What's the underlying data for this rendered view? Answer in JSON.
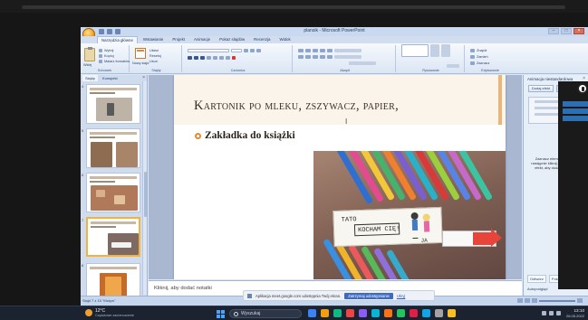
{
  "window": {
    "title": "plansik - Microsoft PowerPoint",
    "controls": [
      "–",
      "□",
      "×"
    ]
  },
  "ribbon": {
    "tabs": [
      "Narzędzia główne",
      "Wstawianie",
      "Projekt",
      "Animacje",
      "Pokaz slajdów",
      "Recenzja",
      "Widok"
    ],
    "active_tab": "Narzędzia główne",
    "groups": [
      "Schowek",
      "Slajdy",
      "Czcionka",
      "Akapit",
      "Rysowanie",
      "Edytowanie"
    ],
    "paste_label": "Wklej",
    "new_slide_label": "Nowy slajd",
    "clipboard_items": [
      "Wytnij",
      "Kopiuj",
      "Malarz formatów"
    ],
    "slides_items": [
      "Układ",
      "Resetuj",
      "Usuń"
    ],
    "editing_items": [
      "Znajdź",
      "Zamień",
      "Zaznacz"
    ]
  },
  "slide_pane": {
    "tabs": [
      "Slajdy",
      "Konspekt"
    ],
    "active_tab": "Slajdy",
    "thumbnails": [
      {
        "num": "4",
        "selected": false
      },
      {
        "num": "5",
        "selected": false
      },
      {
        "num": "6",
        "selected": false
      },
      {
        "num": "7",
        "selected": true
      },
      {
        "num": "8",
        "selected": false
      }
    ]
  },
  "slide": {
    "title": "Kartonik po mleku, zszywacz, papier,",
    "bullet": "Zakładka do książki",
    "photo": {
      "card_top": "TATO",
      "card_mid": "KOCHAM CIĘ!",
      "card_sign": "JA"
    }
  },
  "notes": {
    "placeholder": "Kliknij, aby dodać notatki"
  },
  "task_pane": {
    "title": "Animacja niestandardowa",
    "add_effect": "Dodaj efekt",
    "remove": "Usuń",
    "hint": "Zaznacz element slajdu, a następnie kliknij przycisk Dodaj efekt, aby dodać animację.",
    "footer_buttons": [
      "Odtwórz",
      "Pokaz slajdów"
    ],
    "autopreview": "Autopodgląd"
  },
  "status": {
    "left": "Slajd 7 z 15   \"Motyw\""
  },
  "share_banner": {
    "text": "Aplikacja meet.google.com udostępnia Twój ekran.",
    "button": "Zatrzymaj udostępnianie",
    "link": "Ukryj"
  },
  "taskbar": {
    "weather_temp": "12°C",
    "weather_desc": "Częściowe zachmurzenie",
    "search_placeholder": "Wyszukaj",
    "time": "13:10",
    "date": "26.05.2022",
    "app_colors": [
      "#3b82f6",
      "#f59e0b",
      "#10b981",
      "#ef4444",
      "#8b5cf6",
      "#06b6d4",
      "#f97316",
      "#22c55e",
      "#e11d48",
      "#0ea5e9",
      "#a3a3a3",
      "#fbbf24"
    ]
  },
  "colors": {
    "accent_orange": "#e38b2c",
    "ribbon_blue": "#dbe6f4",
    "share_button": "#3f6bbd"
  }
}
